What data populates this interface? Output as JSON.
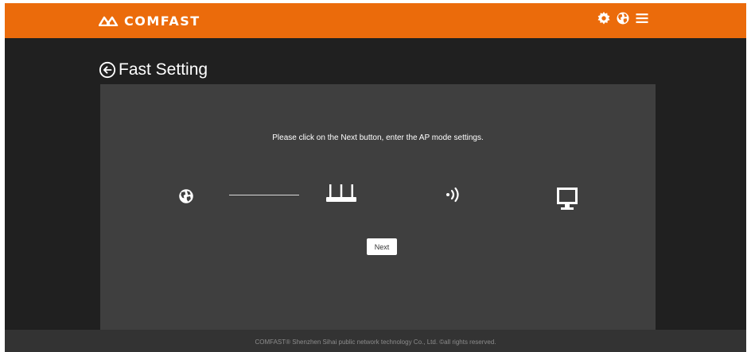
{
  "header": {
    "logo_text": "COMFAST",
    "icons": [
      "gear-icon",
      "globe-icon",
      "menu-icon"
    ]
  },
  "page": {
    "title": "Fast Setting",
    "back_icon": "back-arrow-icon"
  },
  "main": {
    "instruction": "Please click on the Next button, enter the AP mode settings.",
    "diagram_icons": [
      "globe-icon",
      "router-icon",
      "wifi-signal-icon",
      "monitor-icon"
    ],
    "next_label": "Next"
  },
  "footer": {
    "text": "COMFAST® Shenzhen Sihai public network technology Co., Ltd. ©all rights reserved."
  },
  "colors": {
    "brand": "#eb6b0b",
    "background": "#202020",
    "panel": "#3f3f3f",
    "footer": "#333333"
  }
}
